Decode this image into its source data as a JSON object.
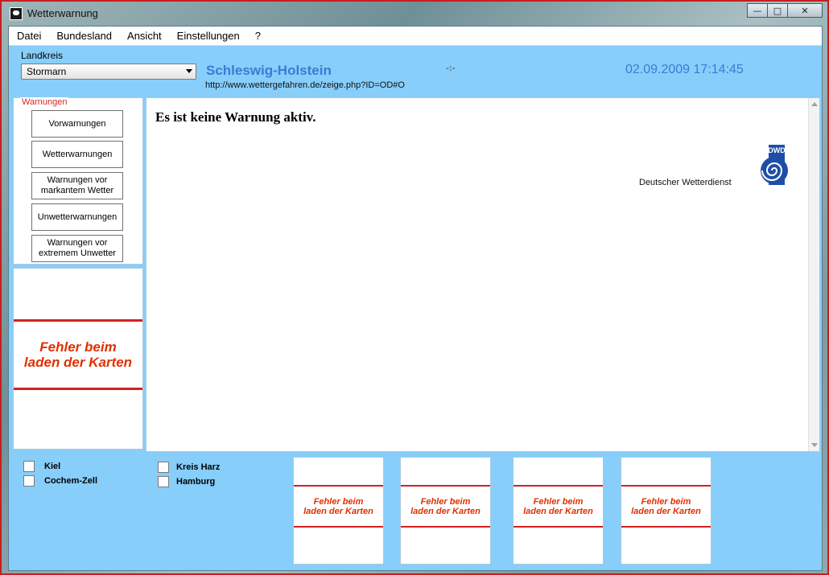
{
  "window": {
    "title": "Wetterwarnung",
    "icon": "app-icon",
    "buttons": {
      "minimize": "—",
      "maximize": "□",
      "close": "✕"
    }
  },
  "menu": [
    "Datei",
    "Bundesland",
    "Ansicht",
    "Einstellungen",
    "?"
  ],
  "landkreis": {
    "label": "Landkreis",
    "selected": "Stormarn"
  },
  "header": {
    "state": "Schleswig-Holstein",
    "url": "http://www.wettergefahren.de/zeige.php?ID=OD#O",
    "center_mark": "-:-",
    "datetime": "02.09.2009 17:14:45"
  },
  "warnings_group": {
    "legend": "Warnungen",
    "buttons": [
      "Vorwarnungen",
      "Wetterwarnungen",
      "Warnungen vor\nmarkantem Wetter",
      "Unwetterwarnungen",
      "Warnungen vor\nextremem Unwetter"
    ]
  },
  "map_error": "Fehler beim\nladen der Karten",
  "content": {
    "message": "Es ist keine Warnung aktiv.",
    "dwd_name": "Deutscher Wetterdienst",
    "dwd_logo_text": "DWD"
  },
  "checkboxes": [
    {
      "label": "Kiel",
      "checked": false
    },
    {
      "label": "Cochem-Zell",
      "checked": false
    },
    {
      "label": "Kreis Harz",
      "checked": false
    },
    {
      "label": "Hamburg",
      "checked": false
    }
  ],
  "thumbnails": [
    {
      "error": "Fehler beim\nladen der Karten"
    },
    {
      "error": "Fehler beim\nladen der Karten"
    },
    {
      "error": "Fehler beim\nladen der Karten"
    },
    {
      "error": "Fehler beim\nladen der Karten"
    }
  ],
  "colors": {
    "panel_bg": "#87cefa",
    "accent_blue": "#3d7ad6",
    "error_red": "#d32020",
    "error_text": "#e03000"
  }
}
